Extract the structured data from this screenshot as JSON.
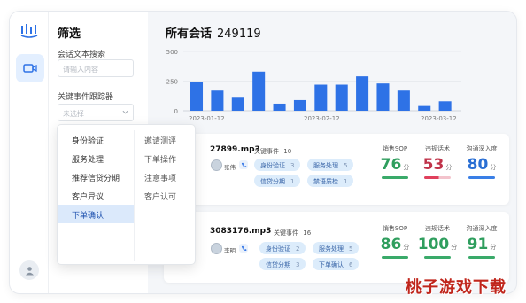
{
  "sidebar": {
    "logo_icon": "bars-logo-icon",
    "nav_icon": "video-camera-icon",
    "avatar_icon": "user-icon"
  },
  "filter": {
    "title": "筛选",
    "text_search_label": "会话文本搜索",
    "text_search_placeholder": "请输入内容",
    "event_tracker_label": "关键事件跟踪器",
    "event_tracker_placeholder": "未选择"
  },
  "dropdown": {
    "col1": [
      "身份验证",
      "服务处理",
      "推荐信贷分期",
      "客户异议",
      "下单确认"
    ],
    "col2": [
      "邀请测评",
      "下单操作",
      "注意事项",
      "客户认可"
    ],
    "active": "下单确认"
  },
  "main": {
    "title": "所有会话",
    "count": "249119"
  },
  "chart_data": {
    "type": "bar",
    "ylim": [
      0,
      500
    ],
    "yticks": [
      "500",
      "250",
      "0"
    ],
    "xticks": [
      "2023-01-12",
      "2023-02-12",
      "2023-03-12"
    ],
    "values": [
      240,
      170,
      110,
      330,
      60,
      90,
      220,
      220,
      290,
      230,
      170,
      40,
      80
    ],
    "color": "#2e72e6"
  },
  "conversations": [
    {
      "file": "27899.mp3",
      "kw_label": "关键事件",
      "kw_count": "10",
      "user": "张伟",
      "tags": [
        {
          "label": "身份验证",
          "n": "3"
        },
        {
          "label": "服务处理",
          "n": "5"
        },
        {
          "label": "信贷分期",
          "n": "1"
        },
        {
          "label": "禁语质检",
          "n": "1"
        }
      ],
      "scores": [
        {
          "label": "销售SOP",
          "value": "76",
          "unit": "分",
          "color": "#2f9e5e",
          "bar": "#3aaa6a"
        },
        {
          "label": "违规话术",
          "value": "53",
          "unit": "分",
          "color": "#c0334a",
          "bar": "#e0405c"
        },
        {
          "label": "沟通深入度",
          "value": "80",
          "unit": "分",
          "color": "#2a6fd4",
          "bar": "#3a7fe6"
        }
      ]
    },
    {
      "file": "3083176.mp3",
      "kw_label": "关键事件",
      "kw_count": "16",
      "user": "李明",
      "tags": [
        {
          "label": "身份验证",
          "n": "2"
        },
        {
          "label": "服务处理",
          "n": "5"
        },
        {
          "label": "信贷分期",
          "n": "3"
        },
        {
          "label": "下单确认",
          "n": "6"
        }
      ],
      "scores": [
        {
          "label": "销售SOP",
          "value": "86",
          "unit": "分",
          "color": "#2f9e5e",
          "bar": "#3aaa6a"
        },
        {
          "label": "违规话术",
          "value": "100",
          "unit": "分",
          "color": "#2f9e5e",
          "bar": "#3aaa6a"
        },
        {
          "label": "沟通深入度",
          "value": "91",
          "unit": "分",
          "color": "#2f9e5e",
          "bar": "#3aaa6a"
        }
      ]
    }
  ],
  "watermark": "桃子游戏下载"
}
